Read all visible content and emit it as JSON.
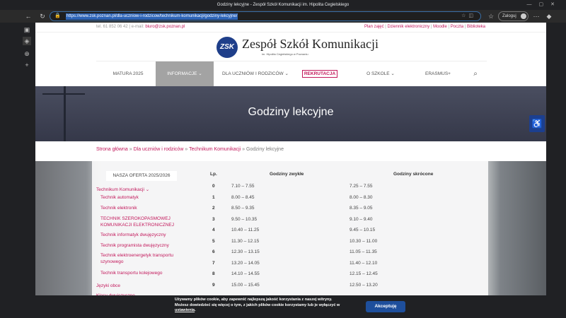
{
  "browser": {
    "title": "Godziny lekcyjne - Zespół Szkół Komunikacji im. Hipolita Cegielskiego",
    "url": "https://www.zsk.poznan.pl/dla-uczniow-i-rodzicow/technikum-komunikacji/godziny-lekcyjne/",
    "profile_label": "Zaloguj"
  },
  "topbar": {
    "phone": "tel. 61 852 06 42",
    "email_prefix": "e-mail:",
    "email": "biuro@zsk.poznan.pl",
    "links": [
      "Plan zajęć",
      "Dziennik elektroniczny",
      "Moodle",
      "Poczta",
      "Biblioteka"
    ]
  },
  "school": {
    "name": "Zespół Szkół Komunikacji",
    "subtitle": "im. Hipolita Cegielskiego w Poznaniu",
    "logo_text": "ZSK"
  },
  "nav": {
    "items": [
      "MATURA 2025",
      "INFORMACJE",
      "DLA UCZNIÓW I RODZICÓW",
      "REKRUTACJA",
      "O SZKOLE",
      "ERASMUS+"
    ]
  },
  "hero": {
    "title": "Godziny lekcyjne"
  },
  "breadcrumbs": {
    "items": [
      "Strona główna",
      "Dla uczniów i rodziców",
      "Technikum Komunikacji"
    ],
    "sep": "»",
    "current": "Godziny lekcyjne"
  },
  "sidebar_menu": {
    "offer": "NASZA OFERTA 2025/2026",
    "technikum": "Technikum Komunikacji",
    "items": [
      "Technik automatyk",
      "Technik elektronik",
      "TECHNIK SZEROKOPASMOWEJ KOMUNIKACJI ELEKTRONICZNEJ",
      "Technik informatyk dwujęzyczny",
      "Technik programista dwujęzyczny",
      "Technik elektroenergetyk transportu szynowego",
      "Technik transportu kolejowego"
    ],
    "extra": [
      "Języki obce",
      "Klasy dwujęzyczne"
    ]
  },
  "schedule": {
    "headers": [
      "Lp.",
      "Godziny zwykłe",
      "Godziny skrócone"
    ],
    "rows": [
      [
        "0",
        "7.10 – 7.55",
        "7.25 – 7.55"
      ],
      [
        "1",
        "8.00 – 8.45",
        "8.00 – 8.30"
      ],
      [
        "2",
        "8.50 – 9.35",
        "8.35 – 9.05"
      ],
      [
        "3",
        "9.50 – 10.35",
        "9.10 – 9.40"
      ],
      [
        "4",
        "10.40 – 11.25",
        "9.45 – 10.15"
      ],
      [
        "5",
        "11.30 – 12.15",
        "10.30 – 11.00"
      ],
      [
        "6",
        "12.30 – 13.15",
        "11.05 – 11.35"
      ],
      [
        "7",
        "13.20 – 14.05",
        "11.40 – 12.10"
      ],
      [
        "8",
        "14.10 – 14.55",
        "12.15 – 12.45"
      ],
      [
        "9",
        "15.00 – 15.45",
        "12.50 – 13.20"
      ]
    ]
  },
  "cookie": {
    "line1": "Używamy plików cookie, aby zapewnić najlepszą jakość korzystania z naszej witryny.",
    "line2": "Możesz dowiedzieć się więcej o tym, z jakich plików cookie korzystamy lub je wyłączyć w",
    "link": "ustawienia",
    "accept": "Akceptuję"
  },
  "colors": {
    "accent": "#c2185b",
    "brand": "#1f3f8a"
  }
}
